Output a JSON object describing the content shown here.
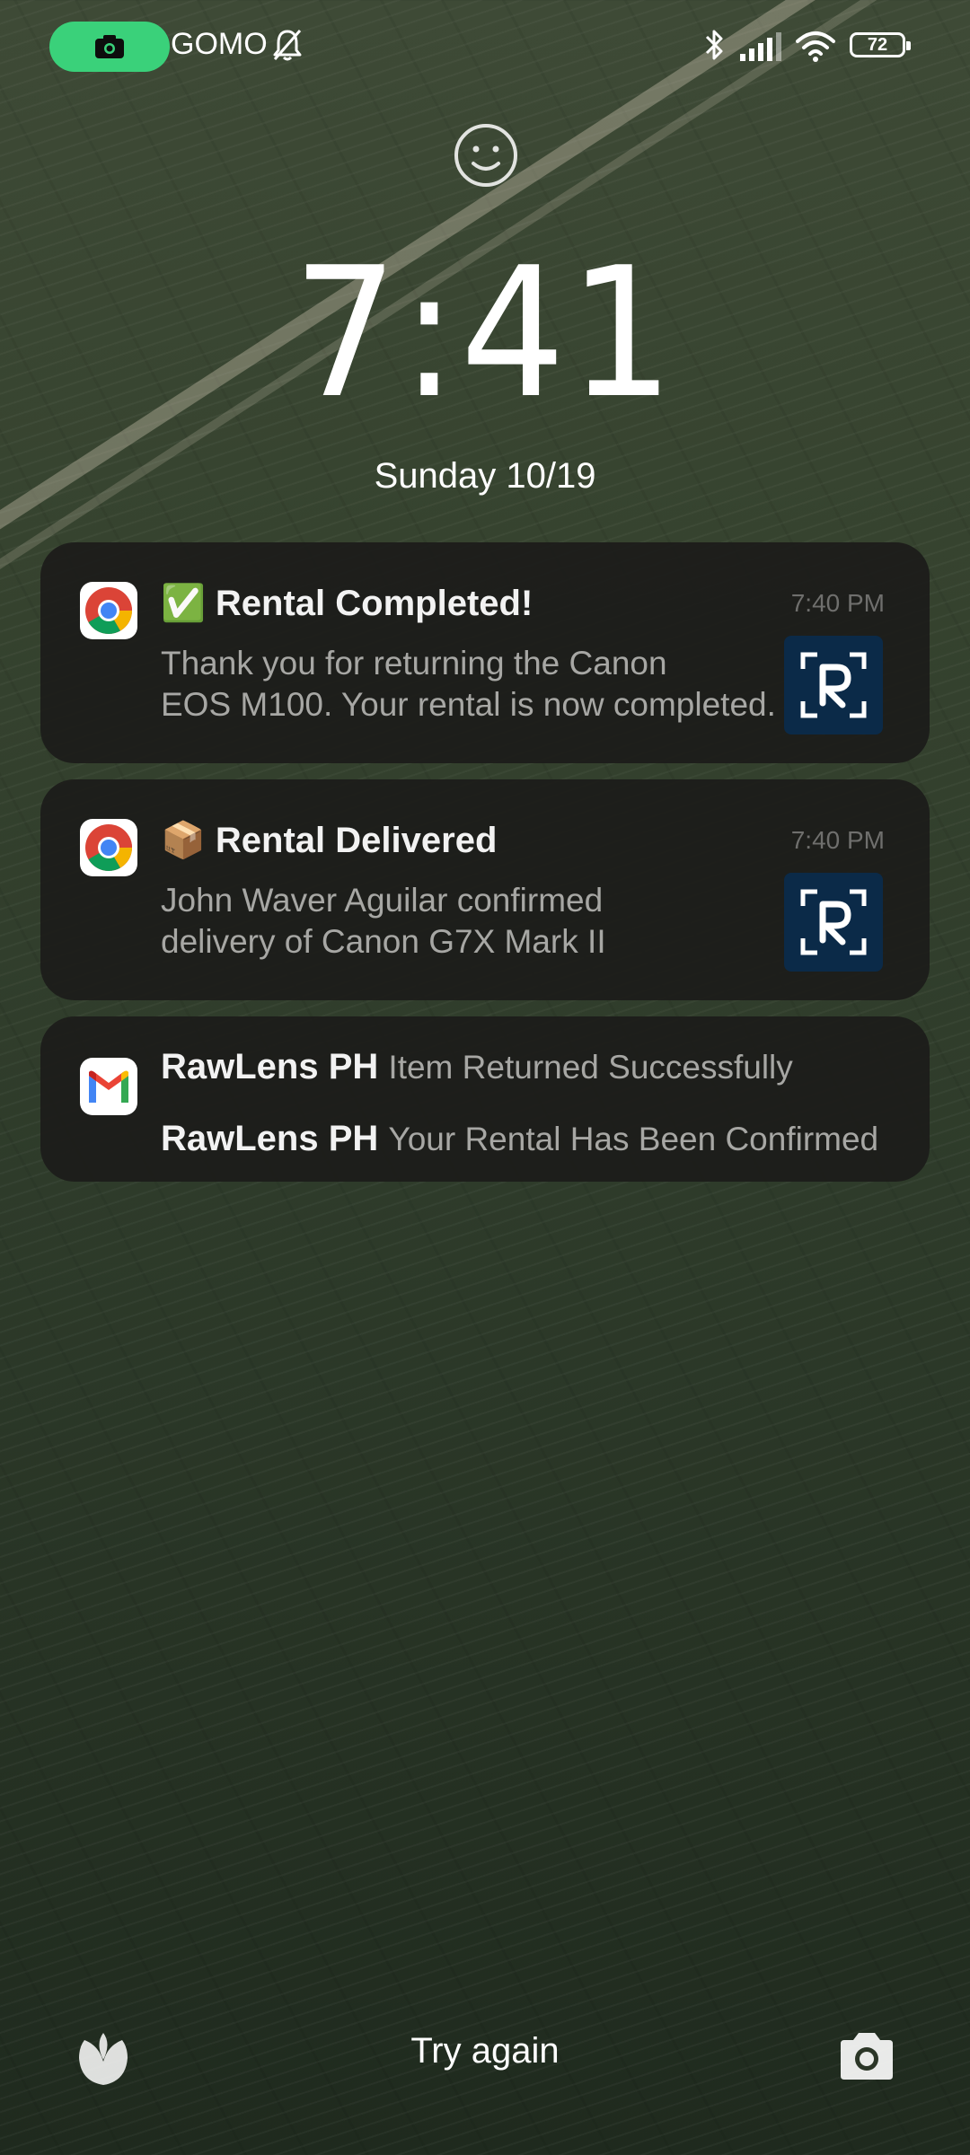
{
  "status_bar": {
    "carrier": "GOMO",
    "battery": "72",
    "record_color": "#3ad17a"
  },
  "lock": {
    "time": "7:41",
    "date": "Sunday 10/19"
  },
  "notifications": [
    {
      "app_icon": "chrome-icon",
      "title": "✅ Rental Completed!",
      "time": "7:40 PM",
      "body_line1": "Thank you for returning the Canon",
      "body_line2": "EOS M100. Your rental is now completed.",
      "thumbnail": "rawlens-logo"
    },
    {
      "app_icon": "chrome-icon",
      "title": "📦 Rental Delivered",
      "time": "7:40 PM",
      "body_line1": "John Waver Aguilar confirmed",
      "body_line2": "delivery of Canon G7X Mark II",
      "thumbnail": "rawlens-logo"
    }
  ],
  "mail_notification": {
    "app_icon": "gmail-icon",
    "items": [
      {
        "sender": "RawLens PH",
        "subject": "Item Returned Successfully"
      },
      {
        "sender": "RawLens PH",
        "subject": "Your Rental Has Been Confirmed"
      }
    ]
  },
  "bottom": {
    "hint": "Try again",
    "left_icon": "leaf-icon",
    "right_icon": "camera-icon"
  }
}
